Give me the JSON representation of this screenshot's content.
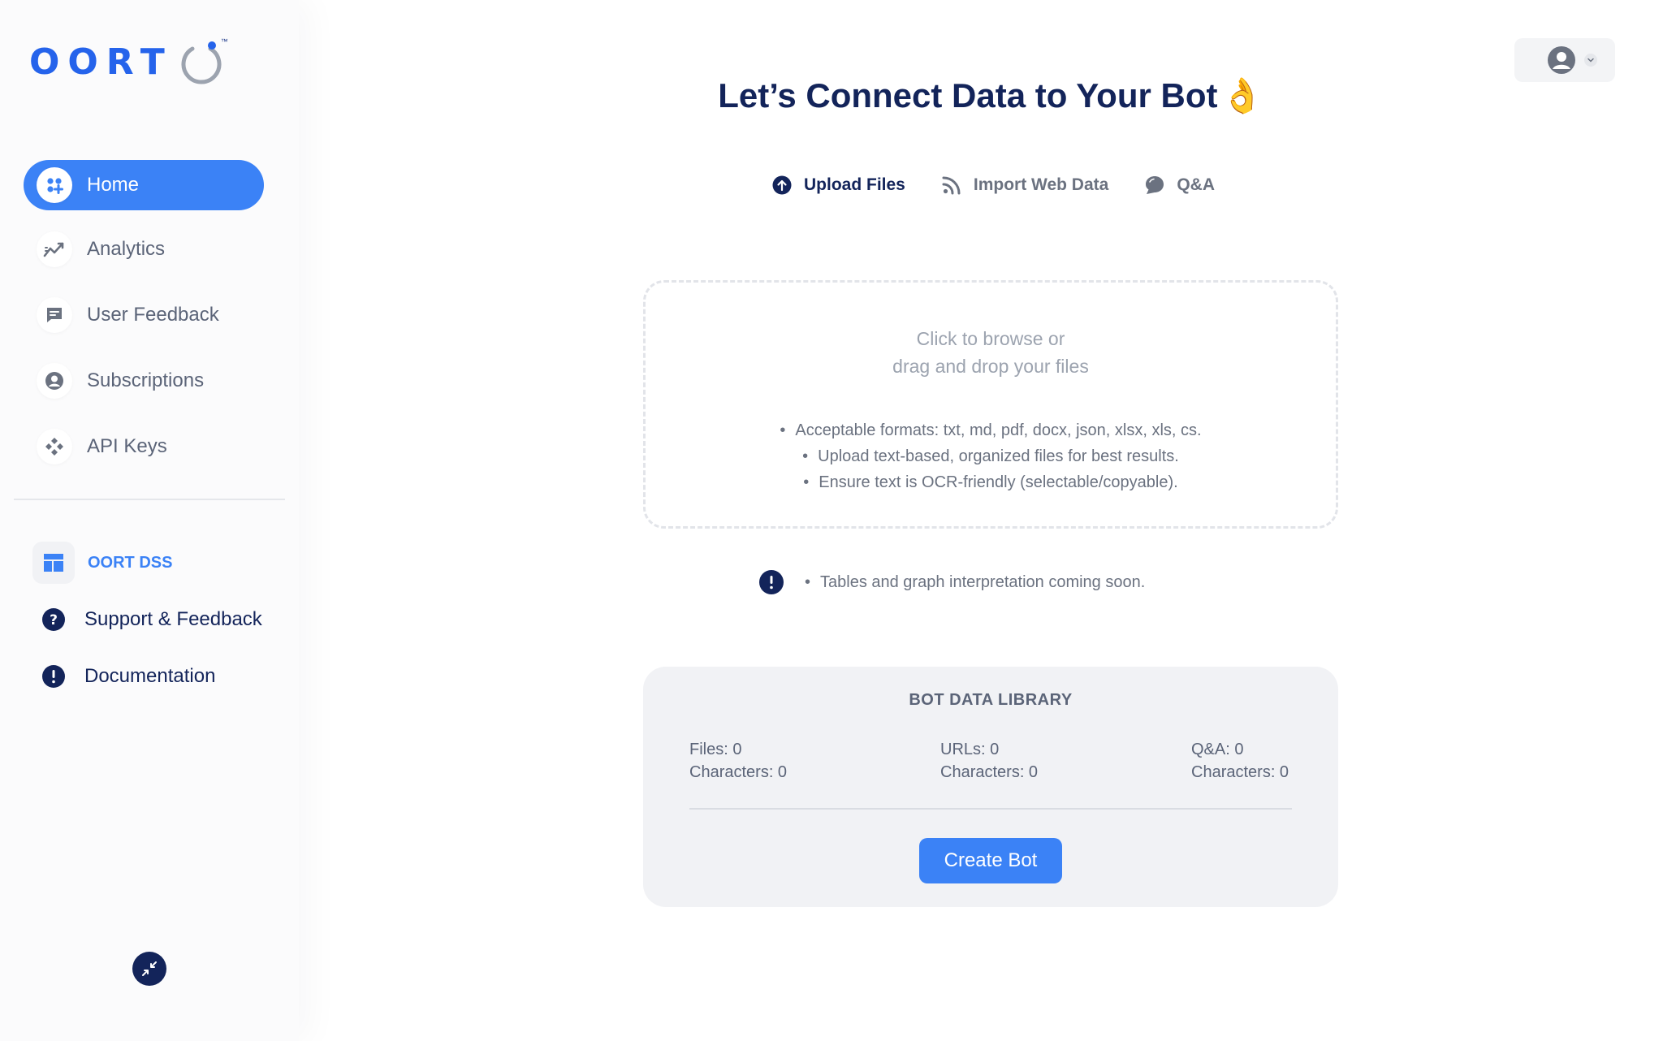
{
  "brand": {
    "logo_text": "OORT",
    "trademark": "™"
  },
  "sidebar": {
    "nav": [
      {
        "label": "Home",
        "icon": "dashboard-grid-icon",
        "active": true
      },
      {
        "label": "Analytics",
        "icon": "trend-chart-icon",
        "active": false
      },
      {
        "label": "User Feedback",
        "icon": "chat-message-icon",
        "active": false
      },
      {
        "label": "Subscriptions",
        "icon": "user-circle-icon",
        "active": false
      },
      {
        "label": "API Keys",
        "icon": "key-diamond-icon",
        "active": false
      }
    ],
    "links": [
      {
        "label": "OORT DSS",
        "icon": "dashboard-layout-icon"
      },
      {
        "label": "Support & Feedback",
        "icon": "question-icon"
      },
      {
        "label": "Documentation",
        "icon": "info-exclamation-icon"
      }
    ]
  },
  "main": {
    "title": "Let’s Connect Data to Your Bot",
    "title_emoji": "👌",
    "tabs": [
      {
        "label": "Upload Files",
        "icon": "upload-arrow-icon",
        "active": true
      },
      {
        "label": "Import Web Data",
        "icon": "rss-feed-icon",
        "active": false
      },
      {
        "label": "Q&A",
        "icon": "chat-bubble-icon",
        "active": false
      }
    ],
    "dropzone": {
      "line1": "Click to browse or",
      "line2": "drag and drop your files",
      "bullets": [
        "Acceptable formats: txt, md, pdf, docx, json, xlsx, xls, cs.",
        "Upload text-based, organized files for best results.",
        "Ensure text is OCR-friendly (selectable/copyable)."
      ]
    },
    "notice": "Tables and graph interpretation coming soon.",
    "library": {
      "title": "BOT DATA LIBRARY",
      "stats": [
        {
          "line1": "Files: 0",
          "line2": "Characters: 0"
        },
        {
          "line1": "URLs: 0",
          "line2": "Characters: 0"
        },
        {
          "line1": "Q&A: 0",
          "line2": "Characters: 0"
        }
      ],
      "create_label": "Create Bot"
    }
  },
  "colors": {
    "accent": "#3b82f6",
    "navy": "#13245a",
    "muted": "#6b7280"
  }
}
